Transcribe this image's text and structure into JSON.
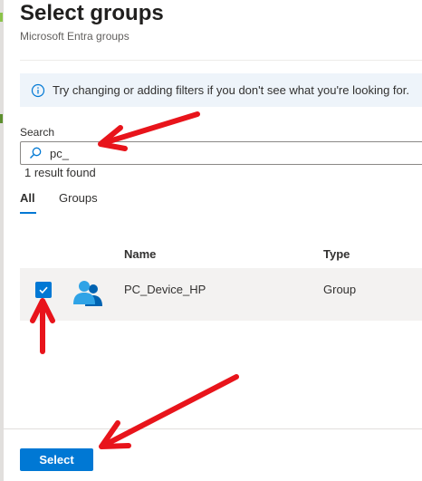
{
  "panel": {
    "title": "Select groups",
    "subtitle": "Microsoft Entra groups"
  },
  "info": {
    "text": "Try changing or adding filters if you don't see what you're looking for."
  },
  "search": {
    "label": "Search",
    "value": "pc_",
    "result_count": "1 result found"
  },
  "tabs": [
    {
      "label": "All",
      "selected": true
    },
    {
      "label": "Groups",
      "selected": false
    }
  ],
  "table": {
    "columns": [
      "Name",
      "Type"
    ],
    "rows": [
      {
        "name": "PC_Device_HP",
        "type": "Group",
        "checked": true,
        "icon": "group-icon"
      }
    ]
  },
  "footer": {
    "select_label": "Select"
  },
  "colors": {
    "accent": "#0078d4",
    "annotation_arrow": "#e8141b",
    "info_background": "#eef4fa",
    "selected_row": "#f3f2f1"
  }
}
